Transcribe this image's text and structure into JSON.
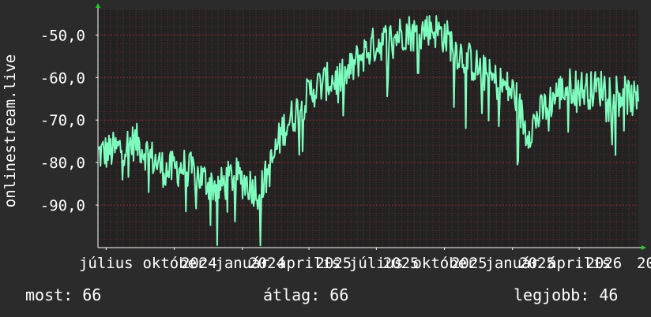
{
  "chart_data": {
    "type": "line",
    "ylabel": "onlinestream.live",
    "ylim": [
      -100,
      -44
    ],
    "xlim": [
      "2024-06-20",
      "2026-06-20"
    ],
    "yticks": [
      {
        "value": -50,
        "label": "-50,0"
      },
      {
        "value": -60,
        "label": "-60,0"
      },
      {
        "value": -70,
        "label": "-70,0"
      },
      {
        "value": -80,
        "label": "-80,0"
      },
      {
        "value": -90,
        "label": "-90,0"
      }
    ],
    "xticks": [
      {
        "date": "2024-07-01",
        "label": "július"
      },
      {
        "date": "2024-10-01",
        "label": "október"
      },
      {
        "date": "2025-01-01",
        "label": "január"
      },
      {
        "date": "2025-04-01",
        "label": "április"
      },
      {
        "date": "2025-07-01",
        "label": "július"
      },
      {
        "date": "2025-10-01",
        "label": "október"
      },
      {
        "date": "2026-01-01",
        "label": "január"
      },
      {
        "date": "2026-04-01",
        "label": "április"
      }
    ],
    "xsublabels": [
      {
        "date": "2024-10-10",
        "label": "2024"
      },
      {
        "date": "2025-01-10",
        "label": "2024"
      },
      {
        "date": "2025-04-10",
        "label": "2025"
      },
      {
        "date": "2025-07-10",
        "label": "2025"
      },
      {
        "date": "2025-10-10",
        "label": "2025"
      },
      {
        "date": "2026-01-10",
        "label": "2025"
      },
      {
        "date": "2026-04-10",
        "label": "2026"
      },
      {
        "date": "2026-06-25",
        "label": "20"
      }
    ],
    "grid": true,
    "colors": {
      "line": "#7fffbf",
      "plot_bg": "#222222",
      "grid": "#8b2f2f",
      "axis": "#ffffff",
      "arrow": "#22cc22"
    },
    "series": [
      {
        "name": "",
        "x": [
          "2024-06-20",
          "2024-07-15",
          "2024-08-10",
          "2024-09-01",
          "2024-09-20",
          "2024-10-15",
          "2024-11-10",
          "2024-11-30",
          "2024-12-20",
          "2025-01-10",
          "2025-01-25",
          "2025-02-10",
          "2025-02-25",
          "2025-03-15",
          "2025-04-05",
          "2025-04-25",
          "2025-05-20",
          "2025-06-10",
          "2025-07-01",
          "2025-07-20",
          "2025-08-10",
          "2025-08-25",
          "2025-09-10",
          "2025-10-01",
          "2025-10-20",
          "2025-11-10",
          "2025-11-30",
          "2025-12-10",
          "2025-12-20",
          "2026-01-05",
          "2026-01-20",
          "2026-02-10",
          "2026-03-01",
          "2026-03-20",
          "2026-04-15",
          "2026-05-10",
          "2026-06-01",
          "2026-06-20"
        ],
        "values": [
          -78,
          -77,
          -75,
          -79,
          -82,
          -81,
          -84,
          -86,
          -83,
          -85,
          -87,
          -80,
          -72,
          -68,
          -63,
          -61,
          -60,
          -55,
          -52,
          -51,
          -49,
          -50,
          -48,
          -50,
          -54,
          -57,
          -60,
          -61,
          -62,
          -64,
          -73,
          -68,
          -64,
          -62,
          -63,
          -62,
          -64,
          -66
        ]
      }
    ]
  },
  "stats": {
    "now": "most: 66",
    "avg": "átlag: 66",
    "best": "legjobb: 46"
  }
}
